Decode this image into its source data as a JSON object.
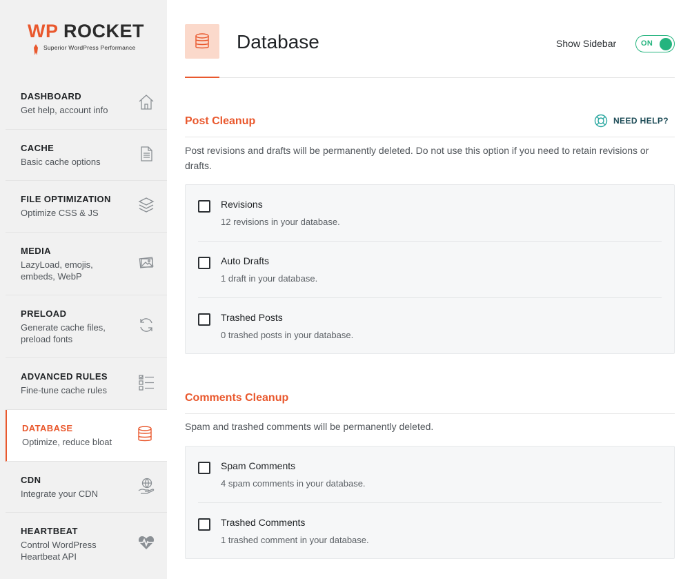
{
  "brand": {
    "logo_prefix": "WP",
    "logo_suffix": " ROCKET",
    "tagline": "Superior WordPress Performance",
    "accent_color": "#e9582d"
  },
  "sidebar": {
    "items": [
      {
        "title": "DASHBOARD",
        "desc": "Get help, account info",
        "icon": "home-icon"
      },
      {
        "title": "CACHE",
        "desc": "Basic cache options",
        "icon": "document-icon"
      },
      {
        "title": "FILE OPTIMIZATION",
        "desc": "Optimize CSS & JS",
        "icon": "layers-icon"
      },
      {
        "title": "MEDIA",
        "desc": "LazyLoad, emojis, embeds, WebP",
        "icon": "images-icon"
      },
      {
        "title": "PRELOAD",
        "desc": "Generate cache files, preload fonts",
        "icon": "refresh-icon"
      },
      {
        "title": "ADVANCED RULES",
        "desc": "Fine-tune cache rules",
        "icon": "checklist-icon"
      },
      {
        "title": "DATABASE",
        "desc": "Optimize, reduce bloat",
        "icon": "database-icon",
        "active": true
      },
      {
        "title": "CDN",
        "desc": "Integrate your CDN",
        "icon": "globe-hand-icon"
      },
      {
        "title": "HEARTBEAT",
        "desc": "Control WordPress Heartbeat API",
        "icon": "heartbeat-icon"
      }
    ]
  },
  "header": {
    "title": "Database",
    "icon": "database-icon",
    "show_sidebar_label": "Show Sidebar",
    "toggle_state": "ON",
    "toggle_color": "#24b47e"
  },
  "post_cleanup": {
    "title": "Post Cleanup",
    "help_label": "NEED HELP?",
    "help_icon": "lifebuoy-icon",
    "description": "Post revisions and drafts will be permanently deleted. Do not use this option if you need to retain revisions or drafts.",
    "options": [
      {
        "label": "Revisions",
        "sub": "12 revisions in your database.",
        "checked": false
      },
      {
        "label": "Auto Drafts",
        "sub": "1 draft in your database.",
        "checked": false
      },
      {
        "label": "Trashed Posts",
        "sub": "0 trashed posts in your database.",
        "checked": false
      }
    ]
  },
  "comments_cleanup": {
    "title": "Comments Cleanup",
    "description": "Spam and trashed comments will be permanently deleted.",
    "options": [
      {
        "label": "Spam Comments",
        "sub": "4 spam comments in your database.",
        "checked": false
      },
      {
        "label": "Trashed Comments",
        "sub": "1 trashed comment in your database.",
        "checked": false
      }
    ]
  }
}
